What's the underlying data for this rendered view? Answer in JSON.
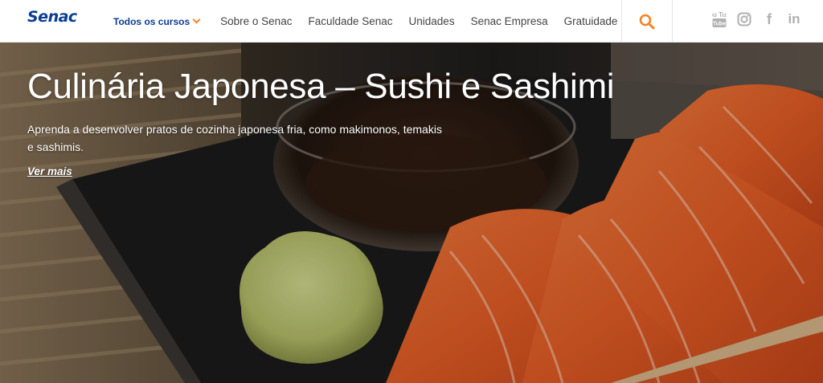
{
  "header": {
    "logo": "Senac",
    "nav": [
      {
        "label": "Todos os cursos"
      },
      {
        "label": "Sobre o Senac"
      },
      {
        "label": "Faculdade Senac"
      },
      {
        "label": "Unidades"
      },
      {
        "label": "Senac Empresa"
      },
      {
        "label": "Gratuidade"
      }
    ],
    "search_icon": "search-icon",
    "socials": [
      {
        "icon": "youtube-icon",
        "label": "You Tube"
      },
      {
        "icon": "instagram-icon"
      },
      {
        "icon": "facebook-icon",
        "label": "f"
      },
      {
        "icon": "linkedin-icon",
        "label": "in"
      }
    ]
  },
  "hero": {
    "title": "Culinária Japonesa – Sushi e Sashimi",
    "description": "Aprenda a desenvolver pratos de cozinha japonesa fria, como makimonos, temakis e sashimis.",
    "link": "Ver mais"
  },
  "colors": {
    "brand_blue": "#0a3d91",
    "accent_orange": "#f58220",
    "nav_text": "#444444",
    "social_gray": "#b0b0b0"
  }
}
